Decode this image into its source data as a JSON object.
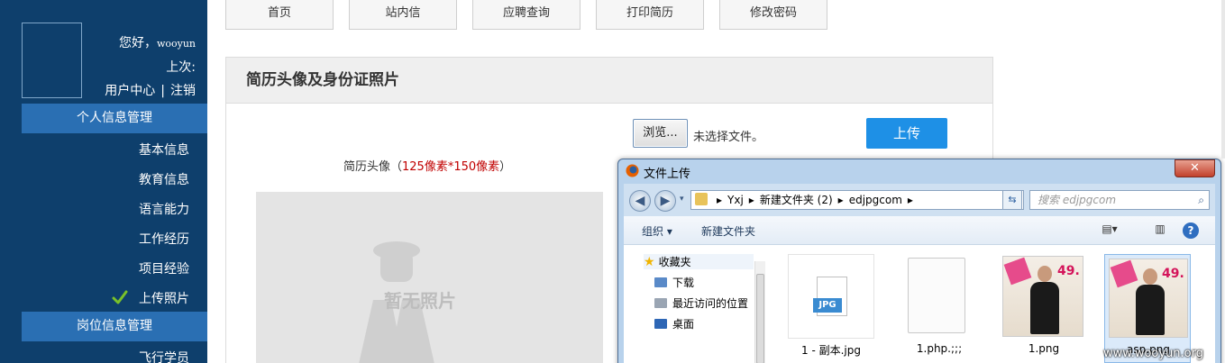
{
  "sidebar": {
    "greeting": "您好，",
    "username": "wooyun",
    "last_label": "上次:",
    "user_center": "用户中心",
    "separator": "|",
    "logout": "注销",
    "section1": "个人信息管理",
    "items": [
      "基本信息",
      "教育信息",
      "语言能力",
      "工作经历",
      "项目经验",
      "上传照片"
    ],
    "section2": "岗位信息管理",
    "item_flight": "飞行学员"
  },
  "nav": {
    "tabs": [
      "首页",
      "站内信",
      "应聘查询",
      "打印简历",
      "修改密码"
    ]
  },
  "panel": {
    "title": "简历头像及身份证照片",
    "browse_label": "浏览...",
    "no_file": "未选择文件。",
    "upload_label": "上传",
    "photo_label": "简历头像（",
    "photo_size": "125像素*150像素",
    "photo_label_end": "）",
    "no_photo": "暂无照片"
  },
  "dialog": {
    "title": "文件上传",
    "close": "✕",
    "path": [
      "Yxj",
      "新建文件夹 (2)",
      "edjpgcom"
    ],
    "search_placeholder": "搜索 edjpgcom",
    "organize": "组织 ▾",
    "new_folder": "新建文件夹",
    "favorites": "收藏夹",
    "downloads": "下载",
    "recent": "最近访问的位置",
    "desktop": "桌面",
    "jpg_badge": "JPG",
    "files": [
      "1 - 副本.jpg",
      "1.php.;;;",
      "1.png",
      "asp.png"
    ],
    "thumb_text": "49."
  },
  "watermark": "www.wooyun.org",
  "colors": {
    "sidebar_bg": "#0e3f6c",
    "section_bg": "#2a6fb3",
    "upload_btn": "#1e90e6",
    "accent_red": "#c00000"
  }
}
